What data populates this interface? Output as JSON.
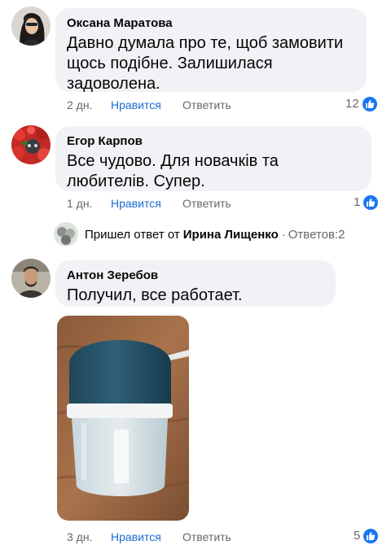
{
  "comments": [
    {
      "author": "Оксана Маратова",
      "text": "Давно думала про те, щоб замовити щось подібне. Залишилася задоволена.",
      "time": "2 дн.",
      "like_label": "Нравится",
      "reply_label": "Ответить",
      "likes": "12"
    },
    {
      "author": "Егор Карпов",
      "text": "Все чудово. Для новачків та любителів. Супер.",
      "time": "1 дн.",
      "like_label": "Нравится",
      "reply_label": "Ответить",
      "likes": "1"
    },
    {
      "author": "Антон Зеребов",
      "text": "Получил, все работает.",
      "time": "3 дн.",
      "like_label": "Нравится",
      "reply_label": "Ответить",
      "likes": "5"
    }
  ],
  "reply_thread": {
    "prefix": "Пришел ответ от",
    "name": "Ирина Лищенко",
    "sep": "·",
    "replies": "Ответов:2"
  },
  "colors": {
    "bubble": "#f0f2f5",
    "like_blue": "#1877f2",
    "meta_gray": "#65676b"
  }
}
